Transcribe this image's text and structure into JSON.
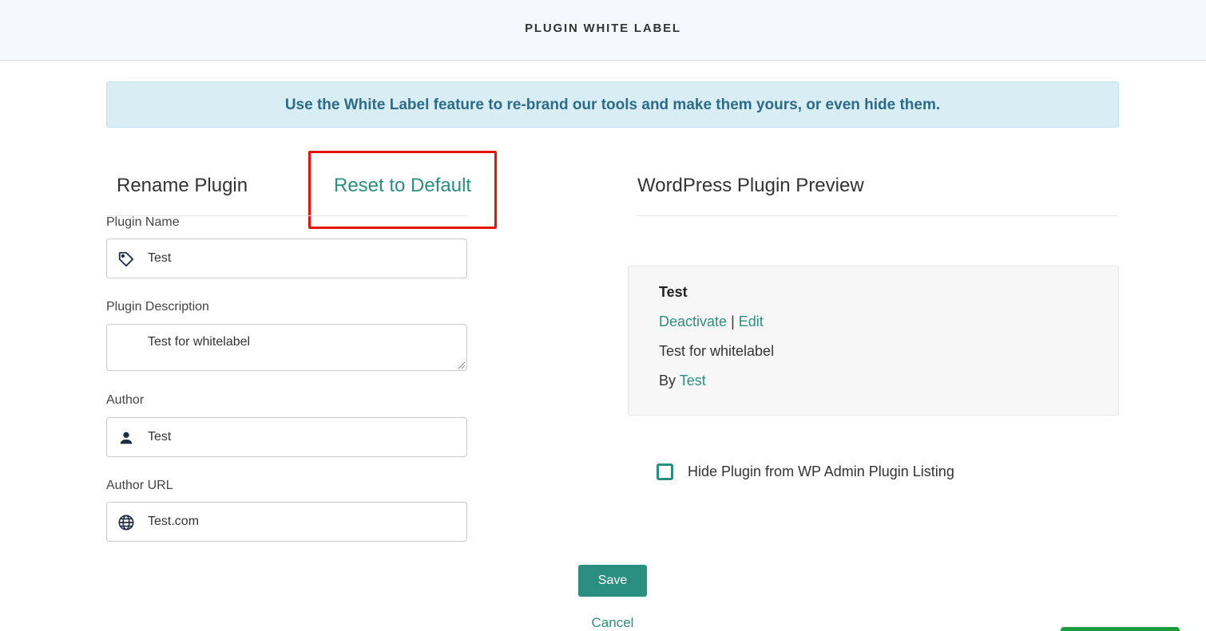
{
  "header": {
    "title": "PLUGIN WHITE LABEL"
  },
  "banner": {
    "text": "Use the White Label feature to re-brand our tools and make them yours, or even hide them."
  },
  "rename_section": {
    "heading": "Rename Plugin",
    "reset_label": "Reset to Default",
    "fields": {
      "plugin_name": {
        "label": "Plugin Name",
        "value": "Test",
        "icon": "tag-icon"
      },
      "plugin_description": {
        "label": "Plugin Description",
        "value": "Test for whitelabel"
      },
      "author": {
        "label": "Author",
        "value": "Test",
        "icon": "user-icon"
      },
      "author_url": {
        "label": "Author URL",
        "value": "Test.com",
        "icon": "globe-icon"
      }
    }
  },
  "preview_section": {
    "heading": "WordPress Plugin Preview",
    "plugin_name": "Test",
    "deactivate_label": "Deactivate",
    "separator": "|",
    "edit_label": "Edit",
    "description": "Test for whitelabel",
    "by_prefix": "By",
    "author": "Test"
  },
  "hide_option": {
    "label": "Hide Plugin from WP Admin Plugin Listing",
    "checked": false
  },
  "actions": {
    "save_label": "Save",
    "cancel_label": "Cancel"
  },
  "colors": {
    "accent": "#2a8f7e",
    "highlight": "#e8120c",
    "banner_bg": "#d9edf5",
    "banner_text": "#2c6c88"
  }
}
